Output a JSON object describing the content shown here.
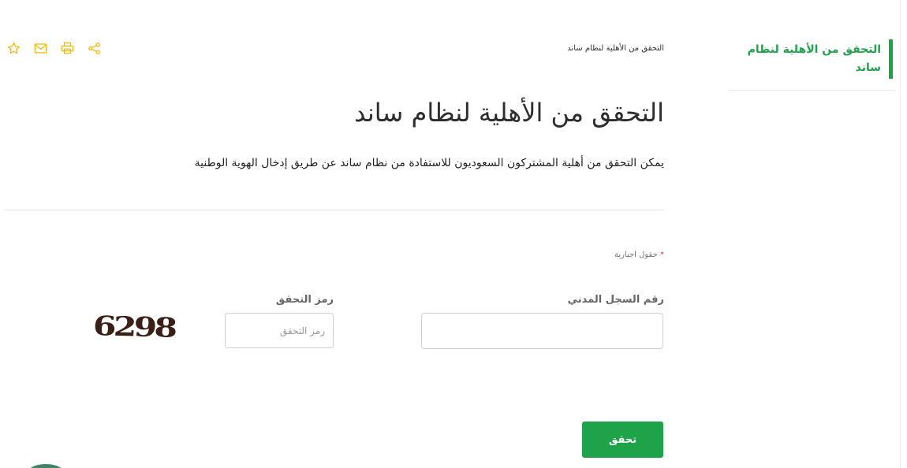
{
  "sidebar": {
    "items": [
      {
        "label": "التحقق من الأهلية لنظام ساند"
      }
    ]
  },
  "toolbar": {
    "icons": [
      "share-icon",
      "print-icon",
      "mail-icon",
      "star-icon"
    ],
    "accent": "#f2b705"
  },
  "breadcrumb": {
    "current": "التحقق من الأهلية لنظام ساند"
  },
  "main": {
    "title": "التحقق من الأهلية لنظام ساند",
    "description": "يمكن التحقق من أهلية المشتركون السعوديون للاستفادة من نظام ساند عن طريق إدخال الهوية الوطنية"
  },
  "form": {
    "required_star": "*",
    "required_note": "حقول اجبارية",
    "id_label": "رقم السجل المدني",
    "id_value": "",
    "code_label": "رمز التحقق",
    "code_placeholder": "رمز التحقق",
    "captcha_text": "6298",
    "submit_label": "تحقق"
  },
  "colors": {
    "brand_green": "#1fa34a",
    "icon_yellow": "#f2b705"
  }
}
